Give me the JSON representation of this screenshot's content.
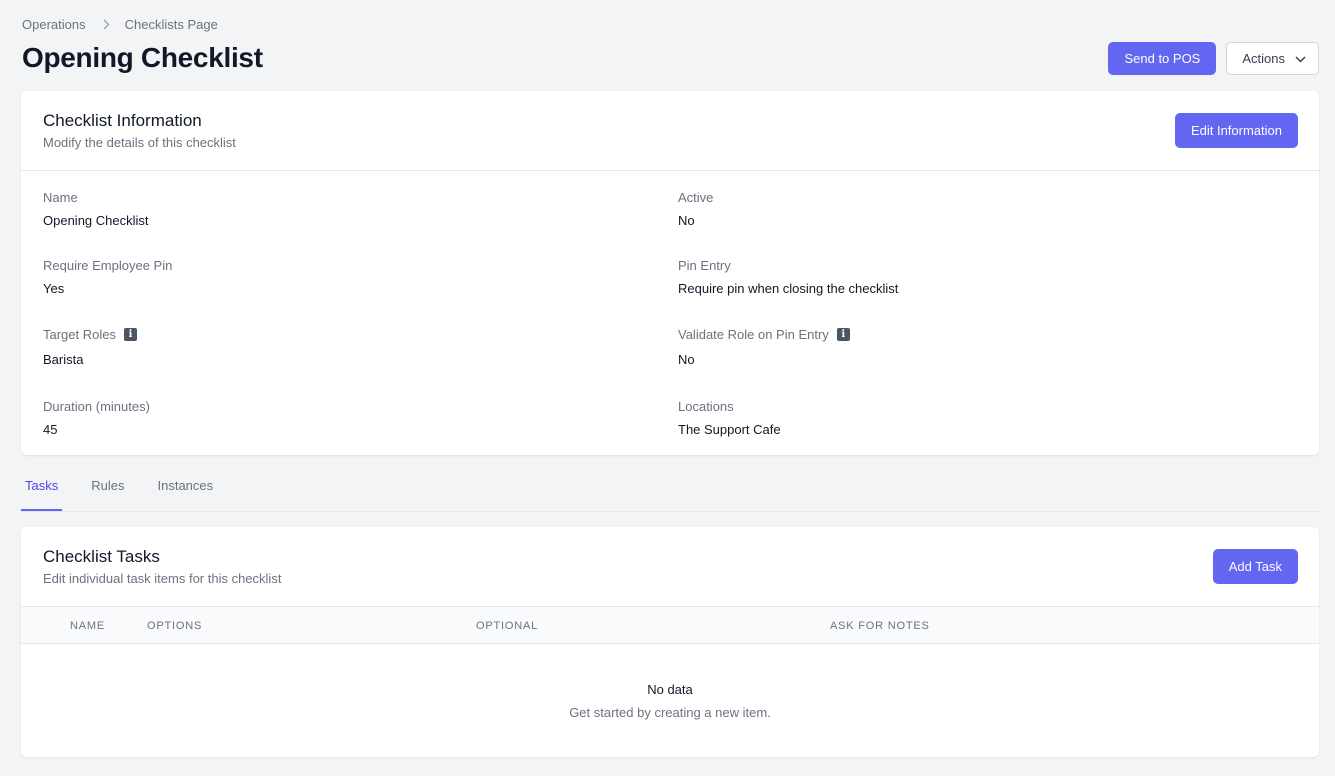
{
  "breadcrumb": {
    "items": [
      "Operations",
      "Checklists Page"
    ]
  },
  "page": {
    "title": "Opening Checklist"
  },
  "header": {
    "send_label": "Send to POS",
    "actions_label": "Actions"
  },
  "info": {
    "title": "Checklist Information",
    "subtitle": "Modify the details of this checklist",
    "edit_label": "Edit Information",
    "fields": [
      {
        "label": "Name",
        "value": "Opening Checklist"
      },
      {
        "label": "Active",
        "value": "No"
      },
      {
        "label": "Require Employee Pin",
        "value": "Yes"
      },
      {
        "label": "Pin Entry",
        "value": "Require pin when closing the checklist"
      },
      {
        "label": "Target Roles",
        "value": "Barista"
      },
      {
        "label": "Validate Role on Pin Entry",
        "value": "No"
      },
      {
        "label": "Duration (minutes)",
        "value": "45"
      },
      {
        "label": "Locations",
        "value": "The Support Cafe"
      }
    ]
  },
  "tabs": [
    {
      "label": "Tasks",
      "active": true
    },
    {
      "label": "Rules",
      "active": false
    },
    {
      "label": "Instances",
      "active": false
    }
  ],
  "tasks": {
    "title": "Checklist Tasks",
    "subtitle": "Edit individual task items for this checklist",
    "add_label": "Add Task",
    "columns": [
      "NAME",
      "OPTIONS",
      "OPTIONAL",
      "ASK FOR NOTES"
    ],
    "empty_title": "No data",
    "empty_subtitle": "Get started by creating a new item."
  },
  "colors": {
    "primary": "#6366f1",
    "active_tab": "#4f46e5",
    "background": "#f3f4f6"
  }
}
